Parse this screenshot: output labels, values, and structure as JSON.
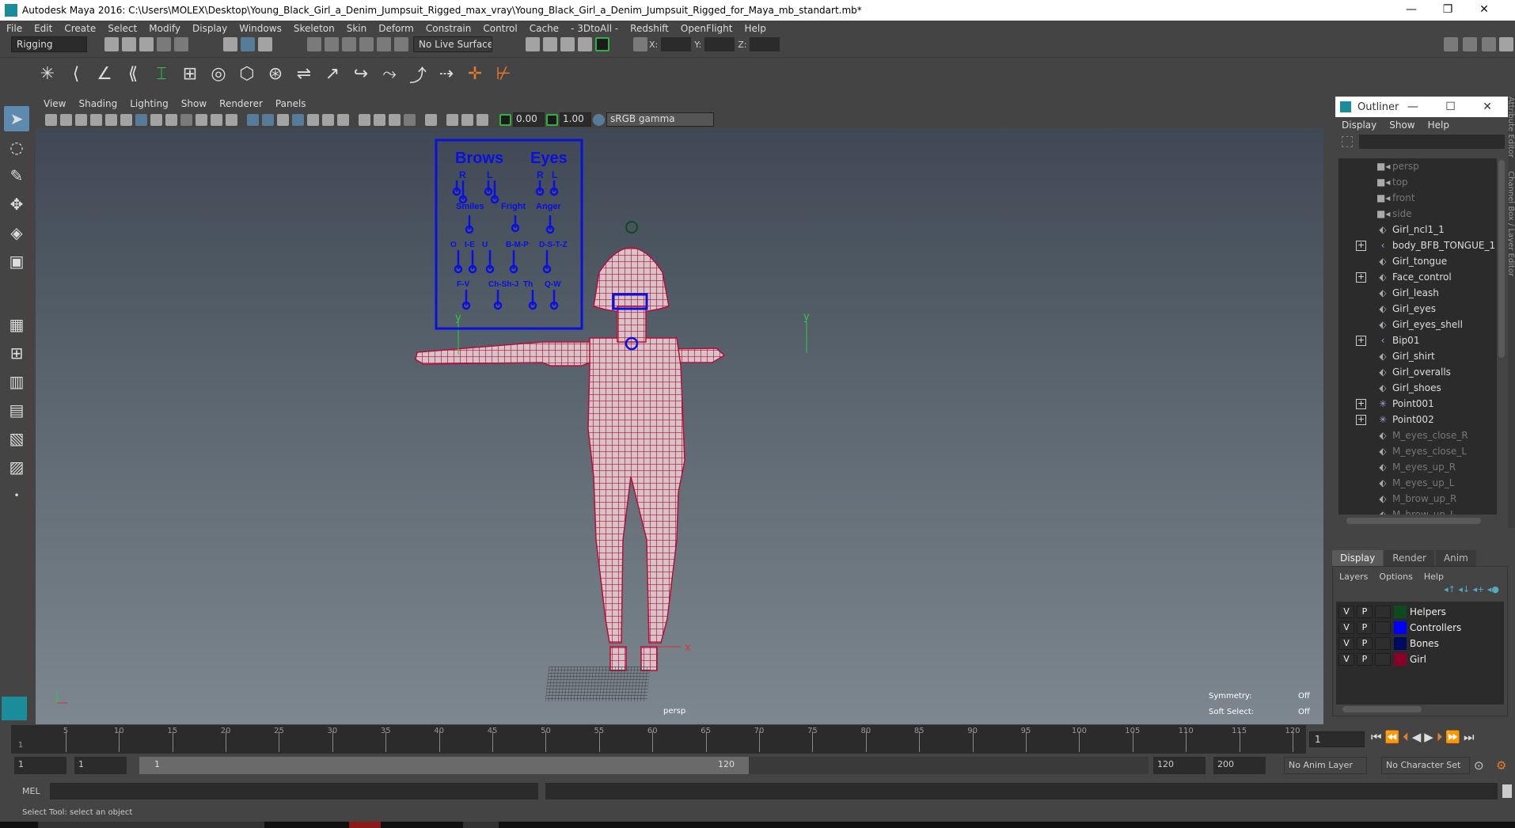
{
  "window": {
    "title": "Autodesk Maya 2016: C:\\Users\\MOLEX\\Desktop\\Young_Black_Girl_a_Denim_Jumpsuit_Rigged_max_vray\\Young_Black_Girl_a_Denim_Jumpsuit_Rigged_for_Maya_mb_standart.mb*",
    "minimize": "—",
    "maximize": "❐",
    "close": "✕"
  },
  "menus": [
    "File",
    "Edit",
    "Create",
    "Select",
    "Modify",
    "Display",
    "Windows",
    "Skeleton",
    "Skin",
    "Deform",
    "Constrain",
    "Control",
    "Cache",
    "- 3DtoAll -",
    "Redshift",
    "OpenFlight",
    "Help"
  ],
  "statusline": {
    "menuset": "Rigging",
    "live_surface": "No Live Surface",
    "x_label": "X:",
    "y_label": "Y:",
    "z_label": "Z:"
  },
  "viewport": {
    "menus": [
      "View",
      "Shading",
      "Lighting",
      "Show",
      "Renderer",
      "Panels"
    ],
    "exposure": "0.00",
    "gamma": "1.00",
    "colorspace": "sRGB gamma",
    "camera_label": "persp",
    "symmetry_label": "Symmetry:",
    "symmetry_value": "Off",
    "soft_select_label": "Soft Select:",
    "soft_select_value": "Off",
    "board": {
      "brows": "Brows",
      "eyes": "Eyes",
      "r": "R",
      "l": "L",
      "smiles": "Smiles",
      "fright": "Fright",
      "anger": "Anger",
      "visemes1": [
        "O",
        "I-E",
        "U",
        "B-M-P",
        "D-S-T-Z"
      ],
      "visemes2": [
        "F-V",
        "Ch-Sh-J",
        "Th",
        "Q-W"
      ]
    },
    "wire_color": "#b0103a",
    "control_color": "#0a10e0"
  },
  "outliner": {
    "title": "Outliner",
    "menus": [
      "Display",
      "Show",
      "Help"
    ],
    "items": [
      {
        "label": "persp",
        "icon": "camera",
        "dim": true
      },
      {
        "label": "top",
        "icon": "camera",
        "dim": true
      },
      {
        "label": "front",
        "icon": "camera",
        "dim": true
      },
      {
        "label": "side",
        "icon": "camera",
        "dim": true
      },
      {
        "label": "Girl_ncl1_1",
        "icon": "mesh"
      },
      {
        "label": "body_BFB_TONGUE_1",
        "icon": "joint",
        "expand": true
      },
      {
        "label": "Girl_tongue",
        "icon": "mesh"
      },
      {
        "label": "Face_control",
        "icon": "mesh",
        "expand": true
      },
      {
        "label": "Girl_leash",
        "icon": "mesh"
      },
      {
        "label": "Girl_eyes",
        "icon": "mesh"
      },
      {
        "label": "Girl_eyes_shell",
        "icon": "mesh"
      },
      {
        "label": "Bip01",
        "icon": "joint",
        "expand": true
      },
      {
        "label": "Girl_shirt",
        "icon": "mesh"
      },
      {
        "label": "Girl_overalls",
        "icon": "mesh"
      },
      {
        "label": "Girl_shoes",
        "icon": "mesh"
      },
      {
        "label": "Point001",
        "icon": "locator",
        "expand": true
      },
      {
        "label": "Point002",
        "icon": "locator",
        "expand": true
      },
      {
        "label": "M_eyes_close_R",
        "icon": "mesh",
        "dim": true
      },
      {
        "label": "M_eyes_close_L",
        "icon": "mesh",
        "dim": true
      },
      {
        "label": "M_eyes_up_R",
        "icon": "mesh",
        "dim": true
      },
      {
        "label": "M_eyes_up_L",
        "icon": "mesh",
        "dim": true
      },
      {
        "label": "M_brow_up_R",
        "icon": "mesh",
        "dim": true
      },
      {
        "label": "M_brow_up_L",
        "icon": "mesh",
        "dim": true
      }
    ],
    "side_tabs": [
      "Attribute Editor",
      "Channel Box / Layer Editor"
    ]
  },
  "layers": {
    "tabs": [
      "Display",
      "Render",
      "Anim"
    ],
    "menus": [
      "Layers",
      "Options",
      "Help"
    ],
    "rows": [
      {
        "v": "V",
        "p": "P",
        "name": "Helpers",
        "color": "#0d4a1e"
      },
      {
        "v": "V",
        "p": "P",
        "name": "Controllers",
        "color": "#0000ff"
      },
      {
        "v": "V",
        "p": "P",
        "name": "Bones",
        "color": "#000a60"
      },
      {
        "v": "V",
        "p": "P",
        "name": "Girl",
        "color": "#8a0028"
      }
    ]
  },
  "timeline": {
    "labels": [
      "5",
      "10",
      "15",
      "20",
      "25",
      "30",
      "35",
      "40",
      "45",
      "50",
      "55",
      "60",
      "65",
      "70",
      "75",
      "80",
      "85",
      "90",
      "95",
      "100",
      "105",
      "110",
      "115",
      "120"
    ],
    "current_frame": "1",
    "start_marker": "1"
  },
  "range": {
    "start": "1",
    "playback_start": "1",
    "slider_start": "1",
    "slider_end": "120",
    "playback_end": "120",
    "end": "200",
    "anim_layer": "No Anim Layer",
    "character_set": "No Character Set"
  },
  "command": {
    "label": "MEL"
  },
  "help_line": "Select Tool: select an object"
}
